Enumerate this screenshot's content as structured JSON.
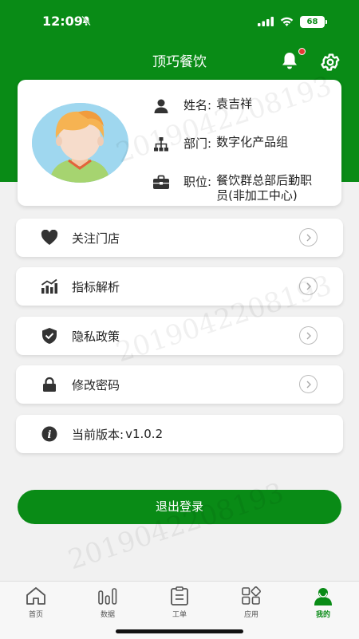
{
  "status_bar": {
    "time": "12:09",
    "battery": "68"
  },
  "header": {
    "title": "顶巧餐饮"
  },
  "profile": {
    "name_label": "姓名:",
    "name_value": "袁吉祥",
    "dept_label": "部门:",
    "dept_value": "数字化产品组",
    "position_label": "职位:",
    "position_value": "餐饮群总部后勤职员(非加工中心)"
  },
  "menu": {
    "follow_stores": "关注门店",
    "metrics_analysis": "指标解析",
    "privacy_policy": "隐私政策",
    "change_password": "修改密码",
    "version_label": "当前版本:",
    "version_value": "v1.0.2"
  },
  "logout_label": "退出登录",
  "watermark_text": "2019042208193",
  "tabs": {
    "home": "首页",
    "data": "数据",
    "workorder": "工单",
    "apps": "应用",
    "mine": "我的"
  },
  "colors": {
    "brand": "#098b16",
    "background": "#f1f1f1",
    "notification_dot": "#e53935"
  },
  "icons": [
    "bell-icon",
    "gear-icon",
    "person-icon",
    "org-chart-icon",
    "briefcase-icon",
    "heart-icon",
    "chart-icon",
    "shield-icon",
    "lock-icon",
    "info-icon",
    "chevron-right-icon",
    "home-icon",
    "bar-chart-icon",
    "clipboard-icon",
    "apps-grid-icon",
    "user-icon"
  ]
}
